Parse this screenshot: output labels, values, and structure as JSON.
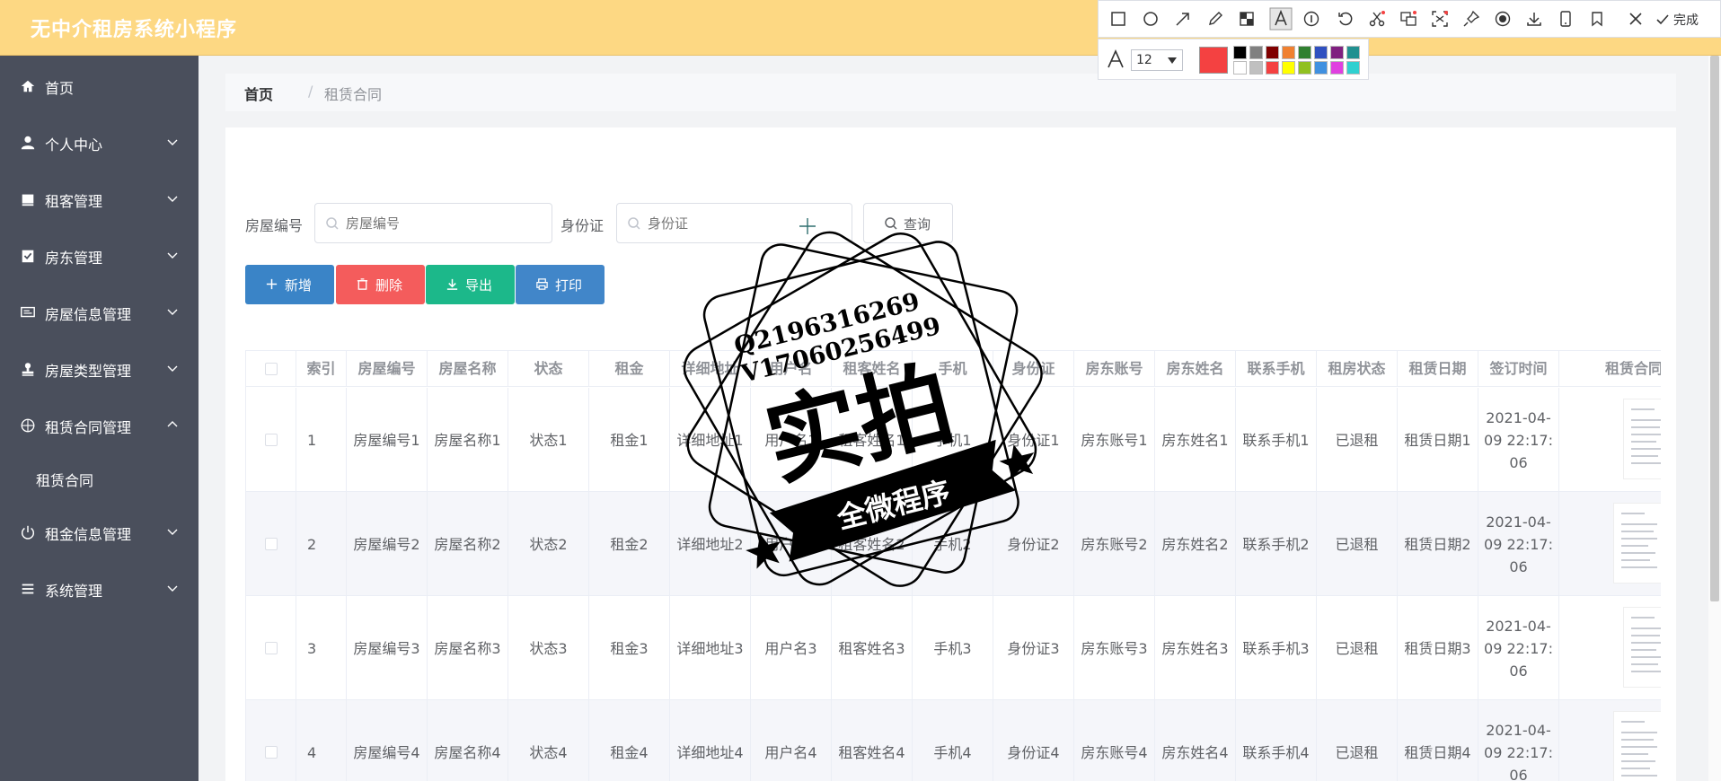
{
  "app": {
    "title": "无中介租房系统小程序"
  },
  "sidebar": {
    "items": [
      {
        "label": "首页",
        "icon": "home-icon",
        "has_arrow": false
      },
      {
        "label": "个人中心",
        "icon": "user-icon",
        "has_arrow": true
      },
      {
        "label": "租客管理",
        "icon": "book-icon",
        "has_arrow": true
      },
      {
        "label": "房东管理",
        "icon": "clipboard-check-icon",
        "has_arrow": true
      },
      {
        "label": "房屋信息管理",
        "icon": "monitor-icon",
        "has_arrow": true
      },
      {
        "label": "房屋类型管理",
        "icon": "stamp-icon",
        "has_arrow": true
      },
      {
        "label": "租赁合同管理",
        "icon": "compass-icon",
        "has_arrow": true,
        "expanded": true
      },
      {
        "label": "租金信息管理",
        "icon": "power-icon",
        "has_arrow": true
      },
      {
        "label": "系统管理",
        "icon": "list-icon",
        "has_arrow": true
      }
    ],
    "sub_item": {
      "label": "租赁合同"
    }
  },
  "breadcrumb": {
    "home": "首页",
    "separator": "/",
    "current": "租赁合同"
  },
  "search": {
    "house_no_label": "房屋编号",
    "house_no_placeholder": "房屋编号",
    "id_card_label": "身份证",
    "id_card_placeholder": "身份证",
    "query_button": "查询"
  },
  "actions": {
    "add": {
      "label": "新增",
      "color": "#3a84c7"
    },
    "delete": {
      "label": "删除",
      "color": "#f45c5c"
    },
    "export": {
      "label": "导出",
      "color": "#1cb88a"
    },
    "print": {
      "label": "打印",
      "color": "#4186c9"
    }
  },
  "table": {
    "headers": [
      "索引",
      "房屋编号",
      "房屋名称",
      "状态",
      "租金",
      "详细地址",
      "用户名",
      "租客姓名",
      "手机",
      "身份证",
      "房东账号",
      "房东姓名",
      "联系手机",
      "租房状态",
      "租赁日期",
      "签订时间",
      "租赁合同"
    ],
    "rows": [
      [
        "1",
        "房屋编号1",
        "房屋名称1",
        "状态1",
        "租金1",
        "详细地址1",
        "用户名1",
        "租客姓名1",
        "手机1",
        "身份证1",
        "房东账号1",
        "房东姓名1",
        "联系手机1",
        "已退租",
        "租赁日期1",
        "2021-04-09 22:17:06"
      ],
      [
        "2",
        "房屋编号2",
        "房屋名称2",
        "状态2",
        "租金2",
        "详细地址2",
        "用户名2",
        "租客姓名2",
        "手机2",
        "身份证2",
        "房东账号2",
        "房东姓名2",
        "联系手机2",
        "已退租",
        "租赁日期2",
        "2021-04-09 22:17:06"
      ],
      [
        "3",
        "房屋编号3",
        "房屋名称3",
        "状态3",
        "租金3",
        "详细地址3",
        "用户名3",
        "租客姓名3",
        "手机3",
        "身份证3",
        "房东账号3",
        "房东姓名3",
        "联系手机3",
        "已退租",
        "租赁日期3",
        "2021-04-09 22:17:06"
      ],
      [
        "4",
        "房屋编号4",
        "房屋名称4",
        "状态4",
        "租金4",
        "详细地址4",
        "用户名4",
        "租客姓名4",
        "手机4",
        "身份证4",
        "房东账号4",
        "房东姓名4",
        "联系手机4",
        "已退租",
        "租赁日期4",
        "2021-04-09 22:17:06"
      ]
    ],
    "row_stripe_color": "#f5f6fa"
  },
  "screenshot_toolbar": {
    "tools": [
      "rectangle-icon",
      "ellipse-icon",
      "arrow-icon",
      "pencil-icon",
      "mosaic-icon",
      "text-icon",
      "number-icon",
      "undo-icon",
      "cut-icon",
      "translate-icon",
      "ocr-icon",
      "pin-icon",
      "record-icon",
      "download-icon",
      "phone-icon",
      "bookmark-icon",
      "close-icon"
    ],
    "done_label": "完成",
    "font_size": "12",
    "current_color": "#f44141",
    "palette": [
      "#000000",
      "#808080",
      "#800000",
      "#f08030",
      "#308030",
      "#3050c0",
      "#802080",
      "#209090",
      "#ffffff",
      "#c0c0c0",
      "#f44141",
      "#ffff00",
      "#90c020",
      "#4090e0",
      "#e040e0",
      "#30d0d0"
    ]
  },
  "watermark": {
    "line1": "Q2196316269",
    "line2": "V17060256499",
    "main": "实拍",
    "banner": "全微程序"
  }
}
